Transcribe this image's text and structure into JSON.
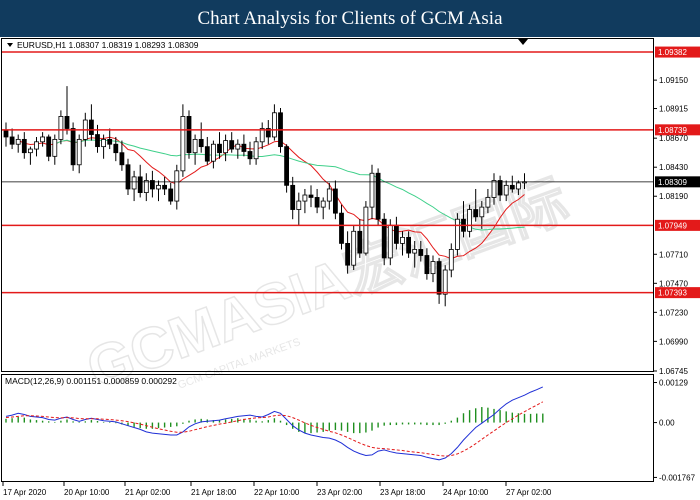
{
  "header": {
    "title": "Chart Analysis for Clients of GCM Asia"
  },
  "watermark": {
    "text": "GCMASIA宏汇国际",
    "subtext": "GCM CAPITAL MARKETS"
  },
  "colors": {
    "header_bg": "#113b5e",
    "level_line": "#e31a1a",
    "ma_fast": "#e31a1a",
    "ma_slow": "#3fd08a",
    "macd_line": "#1f2fd6",
    "signal_line": "#e31a1a",
    "histogram": "#1f8f1f",
    "price_label_bg": "#e31a1a",
    "current_label_bg": "#000000"
  },
  "chart_data": [
    {
      "type": "candlestick",
      "title": "EURUSD,H1  1.08307 1.08319 1.08293 1.08309",
      "ylim": [
        1.06745,
        1.0949
      ],
      "yticks": [
        "1.09382",
        "1.09150",
        "1.08915",
        "1.08670",
        "1.08430",
        "1.08190",
        "1.07949",
        "1.07710",
        "1.07470",
        "1.07230",
        "1.06990",
        "1.06745"
      ],
      "current_price": "1.08309",
      "levels": [
        {
          "value": 1.09382,
          "label": "1.09382"
        },
        {
          "value": 1.08739,
          "label": "1.08739"
        },
        {
          "value": 1.07949,
          "label": "1.07949"
        },
        {
          "value": 1.07393,
          "label": "1.07393"
        }
      ],
      "x_labels": [
        "17 Apr 2020",
        "20 Apr 10:00",
        "21 Apr 02:00",
        "21 Apr 18:00",
        "22 Apr 10:00",
        "23 Apr 02:00",
        "23 Apr 18:00",
        "24 Apr 10:00",
        "27 Apr 02:00"
      ],
      "candles": [
        [
          1.0873,
          1.088,
          1.086,
          1.0868
        ],
        [
          1.0868,
          1.0875,
          1.0858,
          1.0862
        ],
        [
          1.0862,
          1.087,
          1.0855,
          1.0866
        ],
        [
          1.0866,
          1.0872,
          1.085,
          1.0855
        ],
        [
          1.0855,
          1.086,
          1.0845,
          1.0858
        ],
        [
          1.0858,
          1.0868,
          1.0852,
          1.0864
        ],
        [
          1.0864,
          1.0872,
          1.086,
          1.0868
        ],
        [
          1.0868,
          1.087,
          1.0848,
          1.0852
        ],
        [
          1.0852,
          1.087,
          1.0845,
          1.0866
        ],
        [
          1.0866,
          1.089,
          1.0862,
          1.0885
        ],
        [
          1.0885,
          1.091,
          1.087,
          1.0875
        ],
        [
          1.0875,
          1.088,
          1.084,
          1.0845
        ],
        [
          1.0845,
          1.087,
          1.0838,
          1.0866
        ],
        [
          1.0866,
          1.0888,
          1.086,
          1.0882
        ],
        [
          1.0882,
          1.0895,
          1.0865,
          1.087
        ],
        [
          1.087,
          1.0878,
          1.0855,
          1.086
        ],
        [
          1.086,
          1.087,
          1.085,
          1.0866
        ],
        [
          1.0866,
          1.0875,
          1.0858,
          1.0862
        ],
        [
          1.0862,
          1.0868,
          1.0848,
          1.0855
        ],
        [
          1.0855,
          1.0865,
          1.084,
          1.0845
        ],
        [
          1.0845,
          1.085,
          1.082,
          1.0825
        ],
        [
          1.0825,
          1.084,
          1.0815,
          1.0835
        ],
        [
          1.0835,
          1.0845,
          1.0818,
          1.0822
        ],
        [
          1.0822,
          1.0838,
          1.0815,
          1.0832
        ],
        [
          1.0832,
          1.084,
          1.0818,
          1.0825
        ],
        [
          1.0825,
          1.0832,
          1.0815,
          1.0828
        ],
        [
          1.0828,
          1.0835,
          1.082,
          1.0825
        ],
        [
          1.0825,
          1.083,
          1.0812,
          1.0815
        ],
        [
          1.0815,
          1.0845,
          1.0808,
          1.084
        ],
        [
          1.084,
          1.0895,
          1.0835,
          1.0885
        ],
        [
          1.0885,
          1.089,
          1.085,
          1.0855
        ],
        [
          1.0855,
          1.087,
          1.0845,
          1.0866
        ],
        [
          1.0866,
          1.088,
          1.0855,
          1.086
        ],
        [
          1.086,
          1.0868,
          1.0845,
          1.0848
        ],
        [
          1.0848,
          1.0865,
          1.0842,
          1.0862
        ],
        [
          1.0862,
          1.0872,
          1.085,
          1.0855
        ],
        [
          1.0855,
          1.087,
          1.0848,
          1.0865
        ],
        [
          1.0865,
          1.0872,
          1.0855,
          1.0858
        ],
        [
          1.0858,
          1.0866,
          1.085,
          1.0862
        ],
        [
          1.0862,
          1.087,
          1.0852,
          1.0856
        ],
        [
          1.0856,
          1.0864,
          1.0845,
          1.085
        ],
        [
          1.085,
          1.0868,
          1.0845,
          1.0864
        ],
        [
          1.0864,
          1.088,
          1.0858,
          1.0875
        ],
        [
          1.0875,
          1.0882,
          1.0862,
          1.0868
        ],
        [
          1.0868,
          1.0895,
          1.0865,
          1.0888
        ],
        [
          1.0888,
          1.0892,
          1.0855,
          1.086
        ],
        [
          1.086,
          1.0862,
          1.0822,
          1.0828
        ],
        [
          1.0828,
          1.0835,
          1.08,
          1.0808
        ],
        [
          1.0808,
          1.0822,
          1.0795,
          1.0815
        ],
        [
          1.0815,
          1.0825,
          1.0805,
          1.082
        ],
        [
          1.082,
          1.0828,
          1.081,
          1.0818
        ],
        [
          1.0818,
          1.0825,
          1.0805,
          1.081
        ],
        [
          1.081,
          1.0818,
          1.08,
          1.0815
        ],
        [
          1.0815,
          1.083,
          1.0808,
          1.0825
        ],
        [
          1.0825,
          1.0832,
          1.08,
          1.0805
        ],
        [
          1.0805,
          1.0812,
          1.0775,
          1.078
        ],
        [
          1.078,
          1.079,
          1.0755,
          1.0762
        ],
        [
          1.0762,
          1.0795,
          1.0758,
          1.079
        ],
        [
          1.079,
          1.08,
          1.0768,
          1.0772
        ],
        [
          1.0772,
          1.0815,
          1.077,
          1.081
        ],
        [
          1.081,
          1.0845,
          1.08,
          1.0838
        ],
        [
          1.0838,
          1.0842,
          1.0795,
          1.08
        ],
        [
          1.08,
          1.0805,
          1.0762,
          1.0768
        ],
        [
          1.0768,
          1.08,
          1.0762,
          1.0795
        ],
        [
          1.0795,
          1.0802,
          1.0775,
          1.078
        ],
        [
          1.078,
          1.079,
          1.077,
          1.0785
        ],
        [
          1.0785,
          1.079,
          1.0768,
          1.0772
        ],
        [
          1.0772,
          1.0782,
          1.076,
          1.0775
        ],
        [
          1.0775,
          1.0782,
          1.0765,
          1.077
        ],
        [
          1.077,
          1.0776,
          1.075,
          1.0755
        ],
        [
          1.0755,
          1.077,
          1.0748,
          1.0765
        ],
        [
          1.0765,
          1.0768,
          1.073,
          1.0738
        ],
        [
          1.0738,
          1.0762,
          1.0728,
          1.0758
        ],
        [
          1.0758,
          1.078,
          1.0752,
          1.0775
        ],
        [
          1.0775,
          1.0805,
          1.077,
          1.08
        ],
        [
          1.08,
          1.0815,
          1.0785,
          1.079
        ],
        [
          1.079,
          1.0812,
          1.0785,
          1.0808
        ],
        [
          1.0808,
          1.0825,
          1.0798,
          1.0802
        ],
        [
          1.0802,
          1.0815,
          1.0792,
          1.081
        ],
        [
          1.081,
          1.0825,
          1.0805,
          1.0818
        ],
        [
          1.0818,
          1.0838,
          1.0812,
          1.0832
        ],
        [
          1.0832,
          1.0836,
          1.0815,
          1.082
        ],
        [
          1.082,
          1.0832,
          1.0815,
          1.0828
        ],
        [
          1.0828,
          1.0836,
          1.0822,
          1.0825
        ],
        [
          1.0825,
          1.0832,
          1.082,
          1.083
        ],
        [
          1.083,
          1.0838,
          1.0825,
          1.0831
        ]
      ]
    },
    {
      "type": "bar",
      "title": "MACD(12,26,9) 0.001151 0.000859 0.000292",
      "ylim": [
        -0.00185,
        0.0015
      ],
      "yticks": [
        "0.00129",
        "0.00",
        "-0.001767"
      ],
      "x_labels": [
        "17 Apr 2020",
        "20 Apr 10:00",
        "21 Apr 02:00",
        "21 Apr 18:00",
        "22 Apr 10:00",
        "23 Apr 02:00",
        "23 Apr 18:00",
        "24 Apr 10:00",
        "27 Apr 02:00"
      ],
      "macd_line": [
        0.0002,
        0.00024,
        0.0003,
        0.00026,
        0.0002,
        0.00018,
        0.00016,
        0.0001,
        8e-05,
        0.00014,
        0.00018,
        0.0001,
        4e-05,
        0.0001,
        0.00014,
        0.0001,
        6e-05,
        4e-05,
        2e-05,
        -4e-05,
        -0.0001,
        -0.00016,
        -0.00022,
        -0.0003,
        -0.00034,
        -0.00036,
        -0.00038,
        -0.0004,
        -0.0004,
        -0.0003,
        -0.00014,
        -4e-05,
        2e-05,
        4e-05,
        6e-05,
        8e-05,
        0.00012,
        0.00016,
        0.0002,
        0.00022,
        0.00024,
        0.0002,
        0.00018,
        0.00026,
        0.00036,
        0.0003,
        0.0001,
        -0.0001,
        -0.00024,
        -0.00034,
        -0.0004,
        -0.00044,
        -0.00048,
        -0.0005,
        -0.00056,
        -0.00066,
        -0.0008,
        -0.00092,
        -0.001,
        -0.00106,
        -0.00104,
        -0.00092,
        -0.00088,
        -0.00094,
        -0.00098,
        -0.001,
        -0.00102,
        -0.00104,
        -0.00106,
        -0.00112,
        -0.00116,
        -0.0012,
        -0.00114,
        -0.001,
        -0.0008,
        -0.00056,
        -0.00036,
        -0.00016,
        -2e-05,
        0.00012,
        0.00026,
        0.00044,
        0.0006,
        0.00072,
        0.0008,
        0.00088,
        0.00098,
        0.00106,
        0.00115
      ],
      "signal_line": [
        0.00016,
        0.00018,
        0.0002,
        0.00022,
        0.00022,
        0.00021,
        0.0002,
        0.00018,
        0.00016,
        0.00015,
        0.00016,
        0.00015,
        0.00013,
        0.00012,
        0.00012,
        0.00012,
        0.00011,
        0.0001,
        8e-05,
        6e-05,
        3e-05,
        -1e-05,
        -5e-05,
        -0.0001,
        -0.00015,
        -0.0002,
        -0.00024,
        -0.00028,
        -0.00031,
        -0.00031,
        -0.00028,
        -0.00023,
        -0.00018,
        -0.00013,
        -9e-05,
        -5e-05,
        -2e-05,
        2e-05,
        6e-05,
        0.0001,
        0.00013,
        0.00015,
        0.00016,
        0.00018,
        0.00022,
        0.00024,
        0.00022,
        0.00016,
        8e-05,
        -1e-05,
        -9e-05,
        -0.00016,
        -0.00022,
        -0.00028,
        -0.00033,
        -0.0004,
        -0.00048,
        -0.00057,
        -0.00066,
        -0.00074,
        -0.0008,
        -0.00083,
        -0.00084,
        -0.00086,
        -0.00088,
        -0.0009,
        -0.00093,
        -0.00095,
        -0.00097,
        -0.001,
        -0.00103,
        -0.00106,
        -0.00108,
        -0.00106,
        -0.00101,
        -0.00092,
        -0.00081,
        -0.00068,
        -0.00054,
        -0.0004,
        -0.00027,
        -0.00013,
        0.0,
        0.00012,
        0.00024,
        0.00035,
        0.00046,
        0.00056,
        0.00067
      ],
      "histogram": [
        0.00012,
        0.00014,
        0.00018,
        0.00016,
        0.0001,
        8e-05,
        6e-05,
        4e-05,
        2e-05,
        6e-05,
        0.0001,
        4e-05,
        0.0,
        4e-05,
        8e-05,
        5e-05,
        2e-05,
        0.0,
        -2e-05,
        -6e-05,
        -0.0001,
        -0.00014,
        -0.00018,
        -0.0002,
        -0.0002,
        -0.00018,
        -0.00016,
        -0.00014,
        -0.00012,
        -4e-05,
        6e-05,
        0.0001,
        0.00012,
        0.0001,
        8e-05,
        8e-05,
        0.0001,
        0.00012,
        0.00014,
        0.00012,
        0.0001,
        6e-05,
        4e-05,
        8e-05,
        0.00014,
        6e-05,
        -8e-05,
        -0.0002,
        -0.0003,
        -0.00034,
        -0.00034,
        -0.00032,
        -0.0003,
        -0.00026,
        -0.00024,
        -0.00026,
        -0.0003,
        -0.00034,
        -0.00034,
        -0.00032,
        -0.00026,
        -0.00016,
        -0.0001,
        -8e-05,
        -8e-05,
        -6e-05,
        -6e-05,
        -6e-05,
        -6e-05,
        -8e-05,
        -8e-05,
        -8e-05,
        -4e-05,
        6e-05,
        0.00016,
        0.0003,
        0.0004,
        0.00046,
        0.0005,
        0.00048,
        0.00044,
        0.0004,
        0.00036,
        0.00032,
        0.0003,
        0.00028,
        0.00028,
        0.00029,
        0.00029
      ]
    }
  ]
}
